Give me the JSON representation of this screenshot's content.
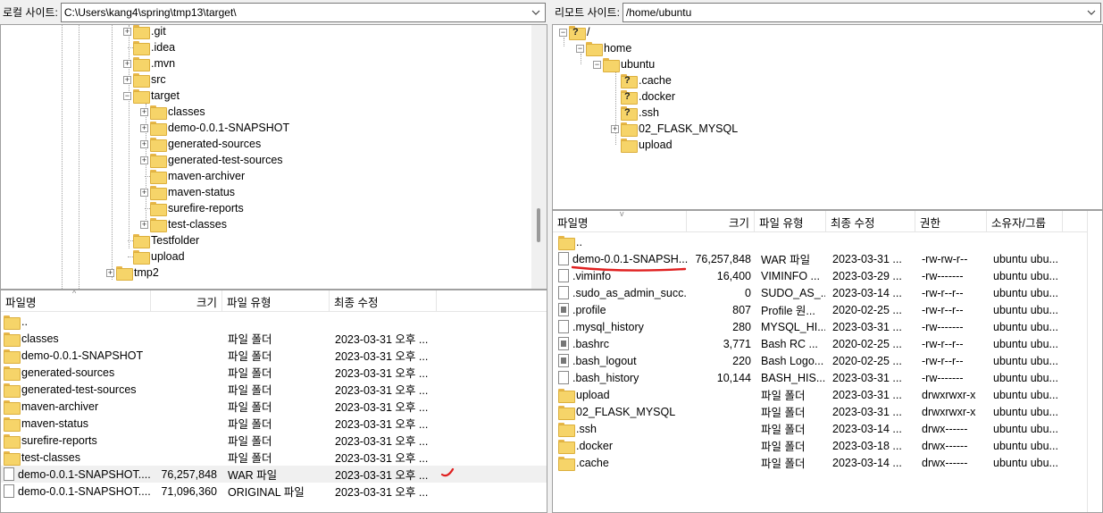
{
  "local": {
    "site_label": "로컬 사이트:",
    "site_path": "C:\\Users\\kang4\\spring\\tmp13\\target\\",
    "tree": [
      {
        "label": ".git",
        "expander": true
      },
      {
        "label": ".idea",
        "expander": false
      },
      {
        "label": ".mvn",
        "expander": true
      },
      {
        "label": "src",
        "expander": true
      },
      {
        "label": "target",
        "expander": "open"
      },
      {
        "label": "classes",
        "expander": true
      },
      {
        "label": "demo-0.0.1-SNAPSHOT",
        "expander": true
      },
      {
        "label": "generated-sources",
        "expander": true
      },
      {
        "label": "generated-test-sources",
        "expander": true
      },
      {
        "label": "maven-archiver",
        "expander": false
      },
      {
        "label": "maven-status",
        "expander": true
      },
      {
        "label": "surefire-reports",
        "expander": false
      },
      {
        "label": "test-classes",
        "expander": true
      },
      {
        "label": "Testfolder",
        "expander": false
      },
      {
        "label": "upload",
        "expander": false
      },
      {
        "label": "tmp2",
        "expander": true
      }
    ],
    "columns": {
      "name": "파일명",
      "size": "크기",
      "type": "파일 유형",
      "modified": "최종 수정"
    },
    "files": [
      {
        "name": "..",
        "size": "",
        "type": "",
        "modified": "",
        "kind": "folder"
      },
      {
        "name": "classes",
        "size": "",
        "type": "파일 폴더",
        "modified": "2023-03-31 오후 ...",
        "kind": "folder"
      },
      {
        "name": "demo-0.0.1-SNAPSHOT",
        "size": "",
        "type": "파일 폴더",
        "modified": "2023-03-31 오후 ...",
        "kind": "folder"
      },
      {
        "name": "generated-sources",
        "size": "",
        "type": "파일 폴더",
        "modified": "2023-03-31 오후 ...",
        "kind": "folder"
      },
      {
        "name": "generated-test-sources",
        "size": "",
        "type": "파일 폴더",
        "modified": "2023-03-31 오후 ...",
        "kind": "folder"
      },
      {
        "name": "maven-archiver",
        "size": "",
        "type": "파일 폴더",
        "modified": "2023-03-31 오후 ...",
        "kind": "folder"
      },
      {
        "name": "maven-status",
        "size": "",
        "type": "파일 폴더",
        "modified": "2023-03-31 오후 ...",
        "kind": "folder"
      },
      {
        "name": "surefire-reports",
        "size": "",
        "type": "파일 폴더",
        "modified": "2023-03-31 오후 ...",
        "kind": "folder"
      },
      {
        "name": "test-classes",
        "size": "",
        "type": "파일 폴더",
        "modified": "2023-03-31 오후 ...",
        "kind": "folder"
      },
      {
        "name": "demo-0.0.1-SNAPSHOT....",
        "size": "76,257,848",
        "type": "WAR 파일",
        "modified": "2023-03-31 오후 ...",
        "kind": "file"
      },
      {
        "name": "demo-0.0.1-SNAPSHOT....",
        "size": "71,096,360",
        "type": "ORIGINAL 파일",
        "modified": "2023-03-31 오후 ...",
        "kind": "file"
      }
    ]
  },
  "remote": {
    "site_label": "리모트 사이트:",
    "site_path": "/home/ubuntu",
    "tree": [
      {
        "label": "/",
        "icon": "question"
      },
      {
        "label": "home",
        "icon": "folder"
      },
      {
        "label": "ubuntu",
        "icon": "folder"
      },
      {
        "label": ".cache",
        "icon": "question"
      },
      {
        "label": ".docker",
        "icon": "question"
      },
      {
        "label": ".ssh",
        "icon": "question"
      },
      {
        "label": "02_FLASK_MYSQL",
        "icon": "folder"
      },
      {
        "label": "upload",
        "icon": "folder"
      }
    ],
    "columns": {
      "name": "파일명",
      "size": "크기",
      "type": "파일 유형",
      "modified": "최종 수정",
      "perm": "권한",
      "owner": "소유자/그룹"
    },
    "files": [
      {
        "name": "..",
        "size": "",
        "type": "",
        "modified": "",
        "perm": "",
        "owner": "",
        "kind": "folder"
      },
      {
        "name": "demo-0.0.1-SNAPSH...",
        "size": "76,257,848",
        "type": "WAR 파일",
        "modified": "2023-03-31 ...",
        "perm": "-rw-rw-r--",
        "owner": "ubuntu ubu...",
        "kind": "file"
      },
      {
        "name": ".viminfo",
        "size": "16,400",
        "type": "VIMINFO ...",
        "modified": "2023-03-29 ...",
        "perm": "-rw-------",
        "owner": "ubuntu ubu...",
        "kind": "file"
      },
      {
        "name": ".sudo_as_admin_succ...",
        "size": "0",
        "type": "SUDO_AS_...",
        "modified": "2023-03-14 ...",
        "perm": "-rw-r--r--",
        "owner": "ubuntu ubu...",
        "kind": "file"
      },
      {
        "name": ".profile",
        "size": "807",
        "type": "Profile 원...",
        "modified": "2020-02-25 ...",
        "perm": "-rw-r--r--",
        "owner": "ubuntu ubu...",
        "kind": "dark"
      },
      {
        "name": ".mysql_history",
        "size": "280",
        "type": "MYSQL_HI...",
        "modified": "2023-03-31 ...",
        "perm": "-rw-------",
        "owner": "ubuntu ubu...",
        "kind": "file"
      },
      {
        "name": ".bashrc",
        "size": "3,771",
        "type": "Bash RC ...",
        "modified": "2020-02-25 ...",
        "perm": "-rw-r--r--",
        "owner": "ubuntu ubu...",
        "kind": "dark"
      },
      {
        "name": ".bash_logout",
        "size": "220",
        "type": "Bash Logo...",
        "modified": "2020-02-25 ...",
        "perm": "-rw-r--r--",
        "owner": "ubuntu ubu...",
        "kind": "dark"
      },
      {
        "name": ".bash_history",
        "size": "10,144",
        "type": "BASH_HIS...",
        "modified": "2023-03-31 ...",
        "perm": "-rw-------",
        "owner": "ubuntu ubu...",
        "kind": "file"
      },
      {
        "name": "upload",
        "size": "",
        "type": "파일 폴더",
        "modified": "2023-03-31 ...",
        "perm": "drwxrwxr-x",
        "owner": "ubuntu ubu...",
        "kind": "folder"
      },
      {
        "name": "02_FLASK_MYSQL",
        "size": "",
        "type": "파일 폴더",
        "modified": "2023-03-31 ...",
        "perm": "drwxrwxr-x",
        "owner": "ubuntu ubu...",
        "kind": "folder"
      },
      {
        "name": ".ssh",
        "size": "",
        "type": "파일 폴더",
        "modified": "2023-03-14 ...",
        "perm": "drwx------",
        "owner": "ubuntu ubu...",
        "kind": "folder"
      },
      {
        "name": ".docker",
        "size": "",
        "type": "파일 폴더",
        "modified": "2023-03-18 ...",
        "perm": "drwx------",
        "owner": "ubuntu ubu...",
        "kind": "folder"
      },
      {
        "name": ".cache",
        "size": "",
        "type": "파일 폴더",
        "modified": "2023-03-14 ...",
        "perm": "drwx------",
        "owner": "ubuntu ubu...",
        "kind": "folder"
      }
    ]
  },
  "colors": {
    "annotation": "#e02020",
    "folder": "#f6d469"
  }
}
